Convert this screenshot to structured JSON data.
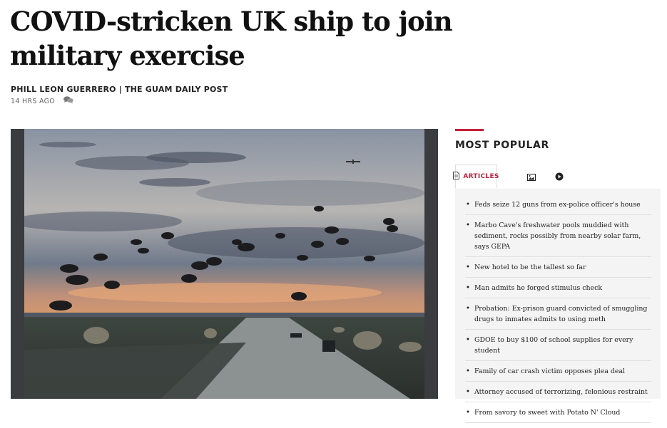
{
  "article": {
    "headline": "COVID-stricken UK ship to join military exercise",
    "byline": "PHILL LEON GUERRERO | THE GUAM DAILY POST",
    "timestamp": "14 HRS AGO",
    "comment_icon": "comment-icon"
  },
  "sidebar": {
    "title": "MOST POPULAR",
    "accent_color": "#c4213c",
    "tabs": [
      {
        "label": "ARTICLES",
        "icon": "document-icon",
        "active": true
      },
      {
        "label": "",
        "icon": "image-icon",
        "active": false
      },
      {
        "label": "",
        "icon": "play-icon",
        "active": false
      }
    ],
    "items": [
      "Feds seize 12 guns from ex-police officer's house",
      "Marbo Cave's freshwater pools muddied with sediment, rocks possibly from nearby solar farm, says GEPA",
      "New hotel to be the tallest so far",
      "Man admits he forged stimulus check",
      "Probation: Ex-prison guard convicted of smuggling drugs to inmates admits to using meth",
      "GDOE to buy $100 of school supplies for every student",
      "Family of car crash victim opposes plea deal",
      "Attorney accused of terrorizing, felonious restraint",
      "From savory to sweet with Potato N' Cloud"
    ]
  }
}
